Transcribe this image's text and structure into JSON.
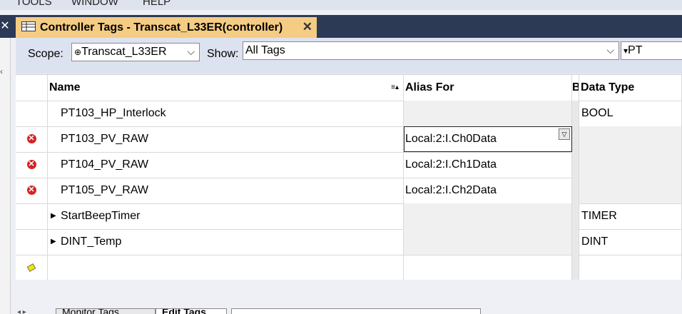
{
  "menu": [
    "TOOLS",
    "WINDOW",
    "HELP"
  ],
  "tab": {
    "title": "Controller Tags - Transcat_L33ER(controller)",
    "close": "✕",
    "icon": "tag-table-icon"
  },
  "toolbar": {
    "scope_label": "Scope:",
    "scope_value": "Transcat_L33ER",
    "show_label": "Show:",
    "show_value": "All Tags",
    "filter_value": "PT"
  },
  "grid": {
    "headers": [
      "Name",
      "Alias For",
      "B",
      "Data Type"
    ],
    "rows": [
      {
        "name": "PT103_HP_Interlock",
        "alias": "",
        "type": "BOOL",
        "error": false,
        "expandable": false
      },
      {
        "name": "PT103_PV_RAW",
        "alias": "Local:2:I.Ch0Data",
        "type": "",
        "error": true,
        "expandable": false
      },
      {
        "name": "PT104_PV_RAW",
        "alias": "Local:2:I.Ch1Data",
        "type": "",
        "error": true,
        "expandable": false
      },
      {
        "name": "PT105_PV_RAW",
        "alias": "Local:2:I.Ch2Data",
        "type": "",
        "error": true,
        "expandable": false
      },
      {
        "name": "StartBeepTimer",
        "alias": "",
        "type": "TIMER",
        "error": false,
        "expandable": true
      },
      {
        "name": "DINT_Temp",
        "alias": "",
        "type": "DINT",
        "error": false,
        "expandable": true
      }
    ]
  },
  "bottom_tabs": [
    "Monitor Tags",
    "Edit Tags"
  ],
  "colors": {
    "tab_active": "#f5cc84",
    "tabstrip": "#2d3a56",
    "error": "#d42424"
  }
}
